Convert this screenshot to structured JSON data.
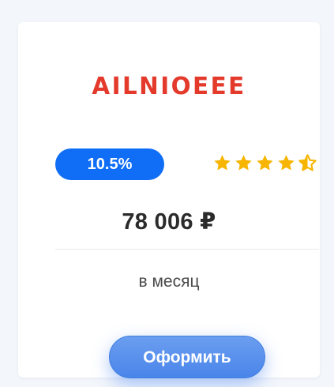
{
  "brand": {
    "name": "AILNIOEEE",
    "color": "#e33a2c"
  },
  "badge": {
    "text": "10.5%",
    "color": "#0f6ef5"
  },
  "rating": {
    "value": 4.5,
    "max": 5,
    "icon": "star-icon",
    "color": "#f7b500"
  },
  "price": {
    "amount": "78 006 ₽"
  },
  "period": {
    "text": "в месяц"
  },
  "cta": {
    "label": "Оформить",
    "color": "#4a85ea"
  }
}
